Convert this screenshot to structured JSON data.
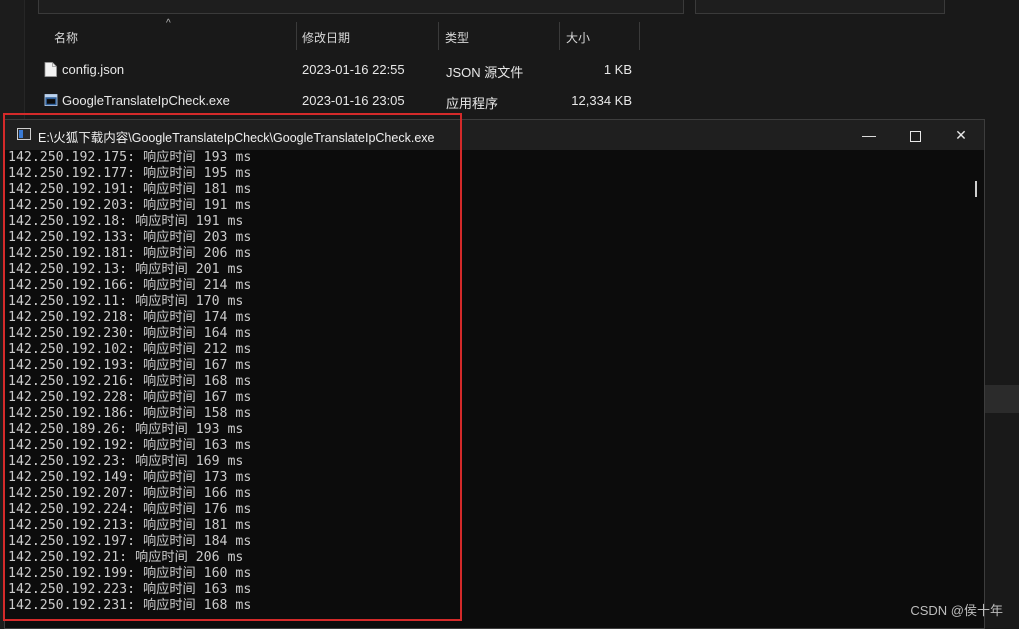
{
  "explorer": {
    "columns": {
      "name": "名称",
      "date": "修改日期",
      "type": "类型",
      "size": "大小"
    },
    "files": [
      {
        "name": "config.json",
        "date": "2023-01-16 22:55",
        "type": "JSON 源文件",
        "size": "1 KB",
        "icon": "json-file-icon"
      },
      {
        "name": "GoogleTranslateIpCheck.exe",
        "date": "2023-01-16 23:05",
        "type": "应用程序",
        "size": "12,334 KB",
        "icon": "exe-file-icon"
      }
    ]
  },
  "console": {
    "title": "E:\\火狐下载内容\\GoogleTranslateIpCheck\\GoogleTranslateIpCheck.exe",
    "controls": {
      "minimize": "—",
      "close": "✕"
    },
    "lines": [
      "142.250.192.175: 响应时间 193 ms",
      "142.250.192.177: 响应时间 195 ms",
      "142.250.192.191: 响应时间 181 ms",
      "142.250.192.203: 响应时间 191 ms",
      "142.250.192.18: 响应时间 191 ms",
      "142.250.192.133: 响应时间 203 ms",
      "142.250.192.181: 响应时间 206 ms",
      "142.250.192.13: 响应时间 201 ms",
      "142.250.192.166: 响应时间 214 ms",
      "142.250.192.11: 响应时间 170 ms",
      "142.250.192.218: 响应时间 174 ms",
      "142.250.192.230: 响应时间 164 ms",
      "142.250.192.102: 响应时间 212 ms",
      "142.250.192.193: 响应时间 167 ms",
      "142.250.192.216: 响应时间 168 ms",
      "142.250.192.228: 响应时间 167 ms",
      "142.250.192.186: 响应时间 158 ms",
      "142.250.189.26: 响应时间 193 ms",
      "142.250.192.192: 响应时间 163 ms",
      "142.250.192.23: 响应时间 169 ms",
      "142.250.192.149: 响应时间 173 ms",
      "142.250.192.207: 响应时间 166 ms",
      "142.250.192.224: 响应时间 176 ms",
      "142.250.192.213: 响应时间 181 ms",
      "142.250.192.197: 响应时间 184 ms",
      "142.250.192.21: 响应时间 206 ms",
      "142.250.192.199: 响应时间 160 ms",
      "142.250.192.223: 响应时间 163 ms",
      "142.250.192.231: 响应时间 168 ms"
    ]
  },
  "watermark": "CSDN @侯十年",
  "colors": {
    "highlight": "#d42a2a",
    "console_bg": "#0c0c0c",
    "explorer_bg": "#191919"
  }
}
